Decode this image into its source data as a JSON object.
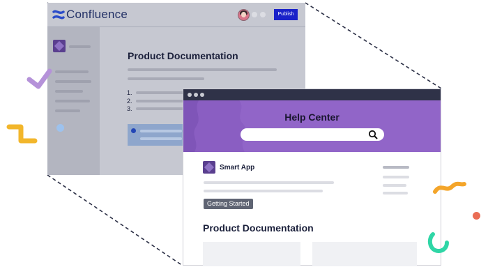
{
  "confluence": {
    "logo_text": "Confluence",
    "publish_label": "Publish",
    "page_title": "Product Documentation",
    "list_numbers": [
      "1.",
      "2.",
      "3."
    ]
  },
  "help_center": {
    "title": "Help Center",
    "search_placeholder": "",
    "app_name": "Smart App",
    "badge": "Getting Started",
    "heading": "Product Documentation"
  },
  "colors": {
    "confluence_bg": "#c6c8d1",
    "publish_button": "#1a22c9",
    "banner_purple": "#9165c8",
    "titlebar_dark": "#2f3248",
    "badge_gray": "#5f6473"
  },
  "icons": [
    "confluence-logo-icon",
    "avatar-icon",
    "space-icon",
    "search-icon",
    "app-icon"
  ]
}
